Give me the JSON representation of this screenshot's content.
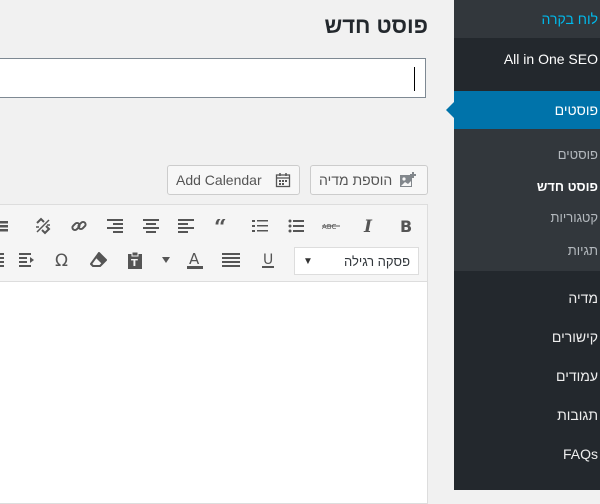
{
  "page": {
    "title": "פוסט חדש"
  },
  "buttons": {
    "add_media": "הוספת מדיה",
    "add_calendar": "Add Calendar"
  },
  "editor": {
    "format_select": "פסקה רגילה"
  },
  "sidebar": {
    "dashboard": "לוח בקרה",
    "seo": "All in One SEO",
    "posts": "פוסטים",
    "submenu": {
      "all_posts": "פוסטים",
      "new_post": "פוסט חדש",
      "categories": "קטגוריות",
      "tags": "תגיות"
    },
    "media": "מדיה",
    "links": "קישורים",
    "pages": "עמודים",
    "comments": "תגובות",
    "faqs": "FAQs"
  },
  "colors": {
    "sidebar_bg": "#23282d",
    "sidebar_active": "#0073aa",
    "link_blue": "#00b9eb"
  },
  "icons": {
    "toolbar_row1": [
      "bold-icon",
      "italic-icon",
      "strikethrough-icon",
      "bullet-list-icon",
      "numbered-list-icon",
      "blockquote-icon",
      "align-left-icon",
      "align-center-icon",
      "align-right-icon",
      "link-icon",
      "unlink-icon",
      "toolbar-toggle-icon"
    ],
    "toolbar_row2": [
      "underline-icon",
      "justify-icon",
      "text-color-icon",
      "paste-text-icon",
      "clear-formatting-icon",
      "special-character-icon",
      "indent-icon",
      "outdent-icon"
    ]
  }
}
